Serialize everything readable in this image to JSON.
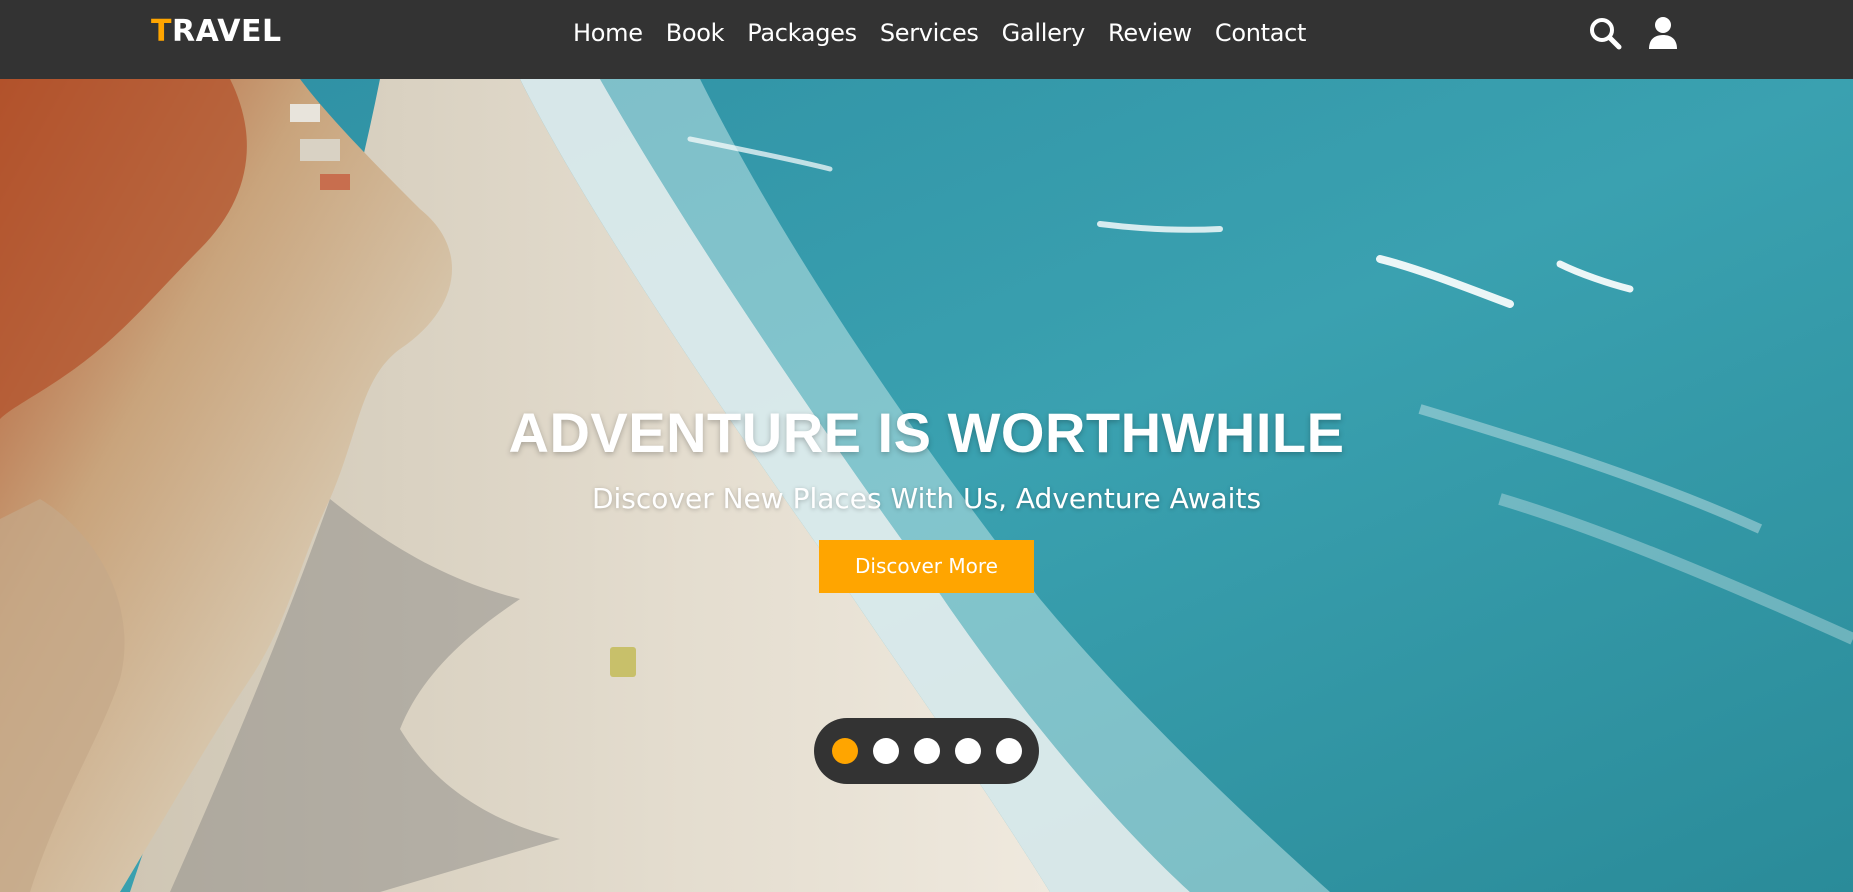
{
  "header": {
    "logo_first_letter": "T",
    "logo_rest": "RAVEL",
    "nav_items": [
      "Home",
      "Book",
      "Packages",
      "Services",
      "Gallery",
      "Review",
      "Contact"
    ],
    "icons": [
      "search-icon",
      "user-icon"
    ]
  },
  "hero": {
    "title": "ADVENTURE IS WORTHWHILE",
    "subtitle": "Discover New Places With Us, Adventure Awaits",
    "cta_label": "Discover More",
    "slider": {
      "count": 5,
      "active_index": 0
    }
  },
  "colors": {
    "accent": "#ffa500",
    "header_bg": "#333333",
    "text": "#ffffff"
  }
}
